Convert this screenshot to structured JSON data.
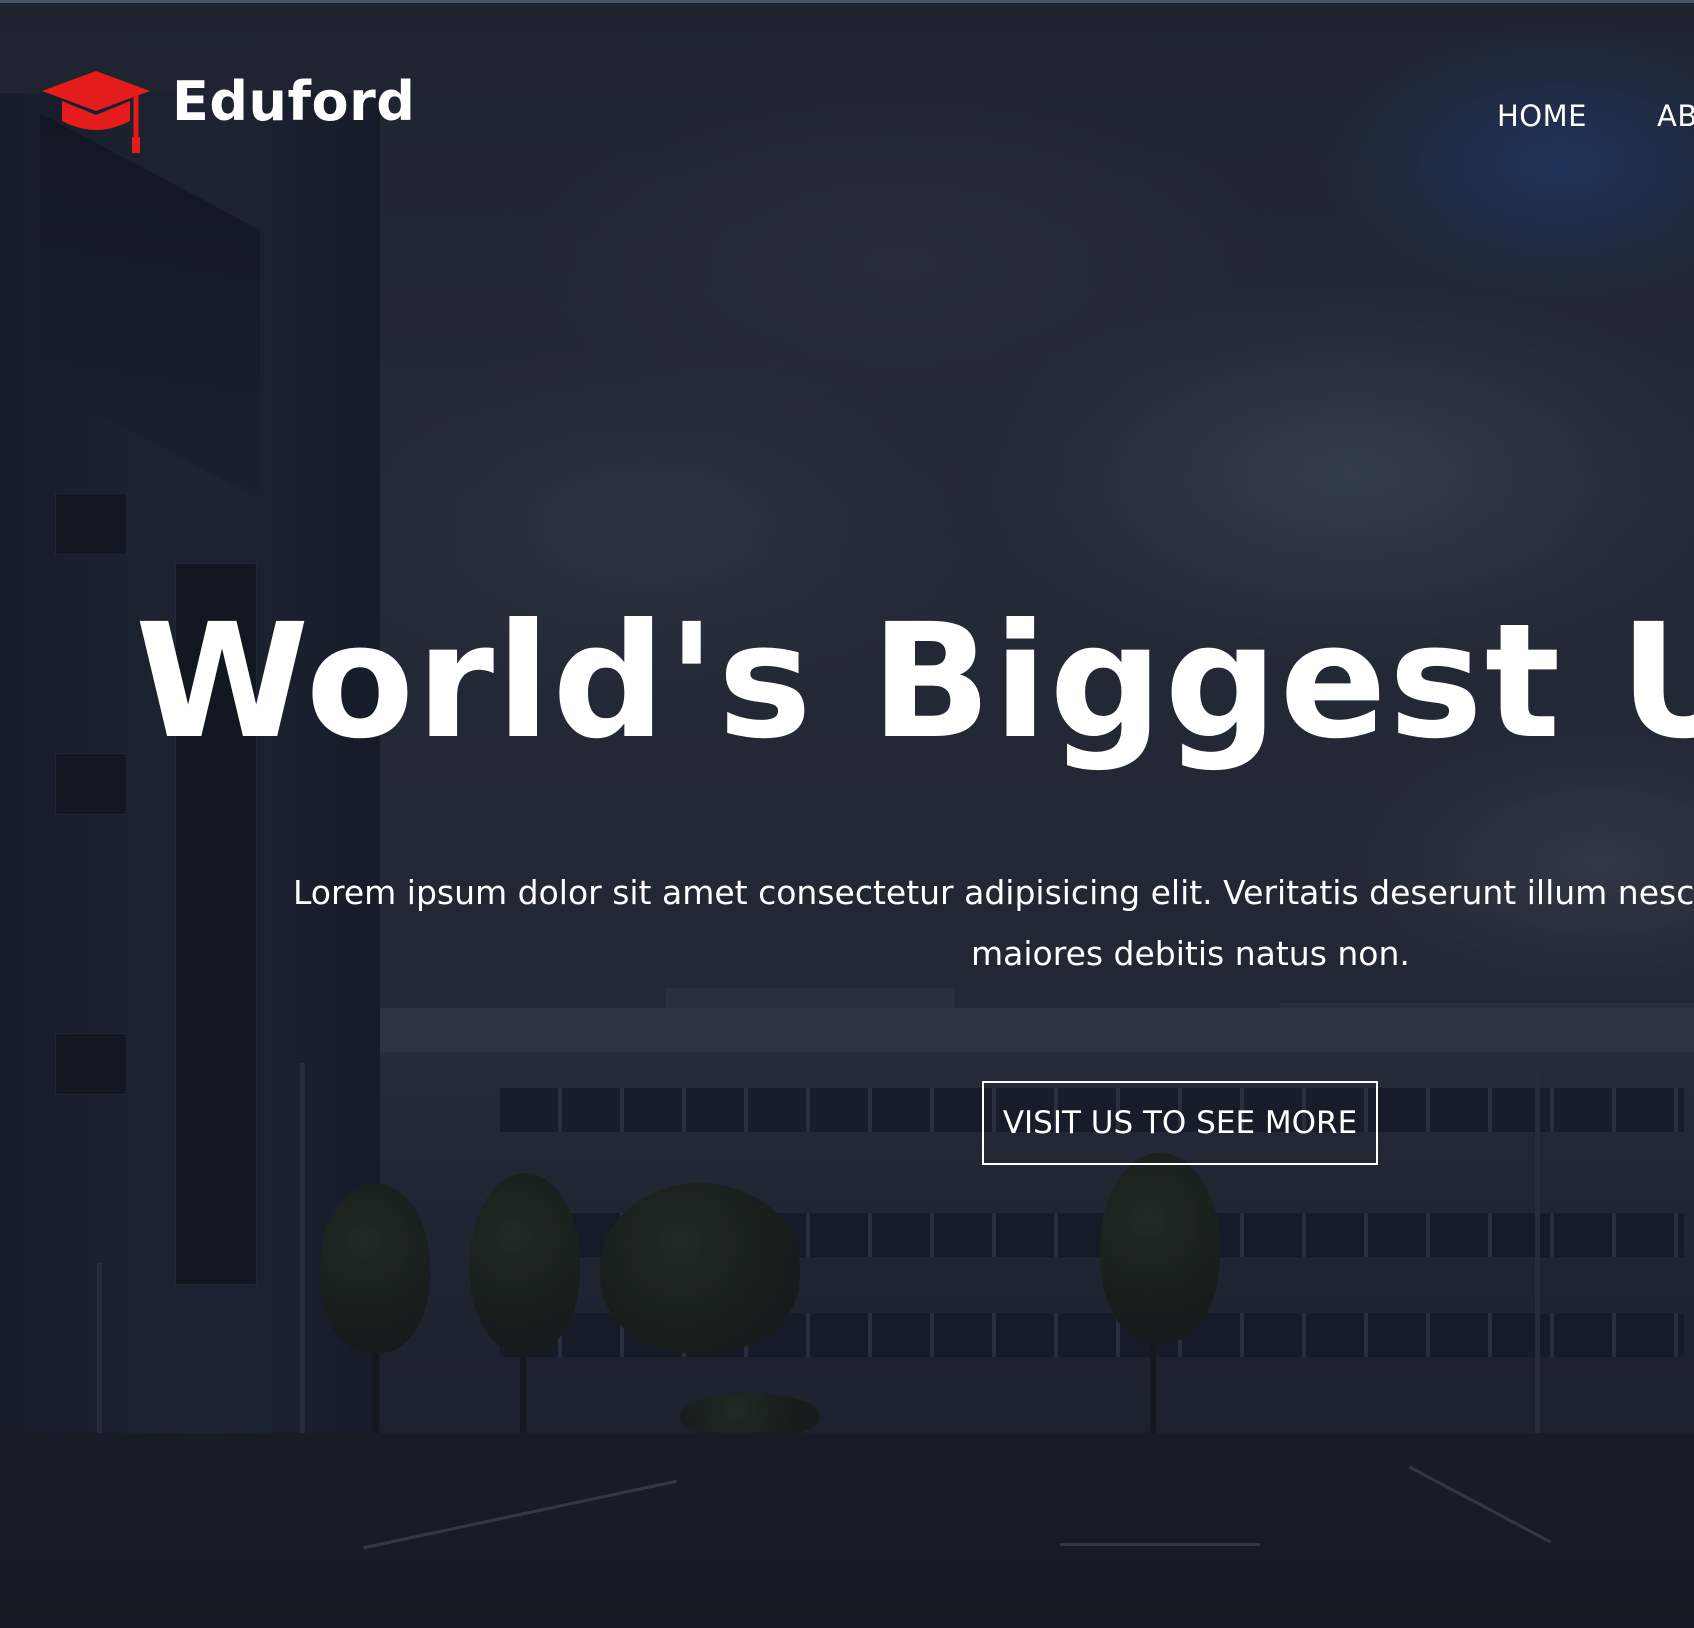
{
  "brand": {
    "name": "Eduford",
    "icon": "graduation-cap-icon",
    "icon_color": "#e61b1b"
  },
  "nav": {
    "items": [
      {
        "label": "HOME"
      },
      {
        "label": "AB"
      }
    ]
  },
  "hero": {
    "headline": "World's Biggest Univ",
    "subtext_line1": "Lorem ipsum dolor sit amet consectetur adipisicing elit. Veritatis deserunt illum nesciunt",
    "subtext_line2": "maiores debitis natus non.",
    "cta_label": "VISIT US TO SEE MORE"
  },
  "colors": {
    "text": "#ffffff",
    "accent": "#e61b1b",
    "overlay": "#0e121e"
  }
}
